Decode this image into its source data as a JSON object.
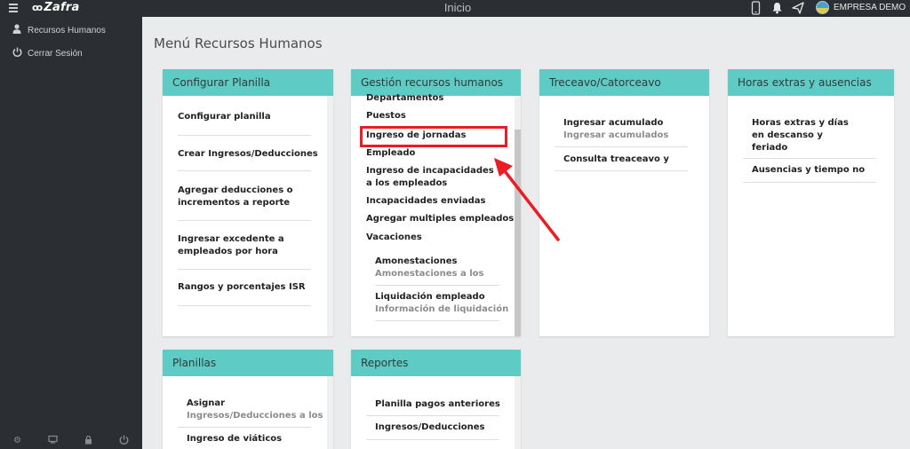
{
  "topbar": {
    "logo": "Zafra",
    "title": "Inicio",
    "company": "EMPRESA DEMO",
    "icons": [
      "menu-icon",
      "mobile-icon",
      "bell-icon",
      "send-icon",
      "avatar",
      "chevron-down-icon"
    ]
  },
  "sidebar": {
    "items": [
      {
        "label": "Recursos Humanos",
        "icon": "user-icon"
      },
      {
        "label": "Cerrar Sesión",
        "icon": "power-icon"
      }
    ],
    "footer_icons": [
      "gear-icon",
      "screen-icon",
      "lock-icon",
      "power-icon"
    ]
  },
  "page_title": "Menú Recursos Humanos",
  "cards": {
    "configurar": {
      "title": "Configurar Planilla",
      "items": [
        "Configurar planilla",
        "Crear Ingresos/Deducciones",
        "Agregar deducciones o incrementos a reporte",
        "Ingresar excedente a empleados por hora",
        "Rangos y porcentajes ISR"
      ]
    },
    "gestion": {
      "title": "Gestión recursos humanos",
      "items": [
        "Departamentos",
        "Puestos",
        "Ingreso de jornadas",
        "Empleado",
        "Ingreso de incapacidades a los empleados",
        "Incapacidades enviadas",
        "Agregar multiples empleados",
        "Vacaciones"
      ],
      "sub_items": [
        {
          "label": "Amonestaciones",
          "sub": "Amonestaciones a los"
        },
        {
          "label": "Liquidación empleado",
          "sub": "Información de liquidación"
        }
      ]
    },
    "treceavo": {
      "title": "Treceavo/Catorceavo",
      "items": [
        {
          "label": "Ingresar acumulado",
          "sub": "Ingresar acumulados"
        },
        {
          "label": "Consulta treaceavo y",
          "sub": ""
        }
      ]
    },
    "horas": {
      "title": "Horas extras y ausencias",
      "items": [
        "Horas extras y días en descanso y feriado",
        "Ausencias y tiempo no"
      ]
    },
    "planillas": {
      "title": "Planillas",
      "items": [
        {
          "label": "Asignar",
          "sub": "Ingresos/Deducciones a los"
        },
        {
          "label": "Ingreso de viáticos",
          "sub": ""
        }
      ]
    },
    "reportes": {
      "title": "Reportes",
      "items": [
        "Planilla pagos anteriores",
        "Ingresos/Deducciones"
      ]
    }
  },
  "colors": {
    "sidebar": "#2b2e32",
    "card_header": "#5ecbc4",
    "background": "#e9ebed",
    "highlight": "#ec1c24"
  }
}
